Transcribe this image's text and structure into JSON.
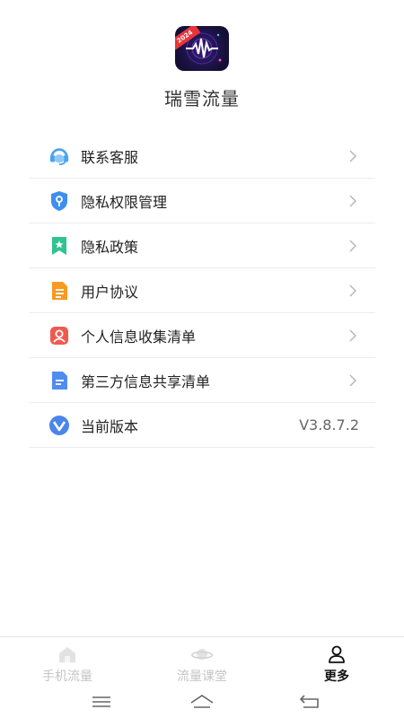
{
  "header": {
    "app_name": "瑞雪流量",
    "logo_badge": "2024"
  },
  "menu": {
    "items": [
      {
        "label": "联系客服",
        "icon": "customer-service-headset-icon"
      },
      {
        "label": "隐私权限管理",
        "icon": "privacy-shield-icon"
      },
      {
        "label": "隐私政策",
        "icon": "policy-bookmark-icon"
      },
      {
        "label": "用户协议",
        "icon": "document-icon"
      },
      {
        "label": "个人信息收集清单",
        "icon": "person-icon"
      },
      {
        "label": "第三方信息共享清单",
        "icon": "share-file-icon"
      },
      {
        "label": "当前版本",
        "icon": "version-v-icon",
        "value": "V3.8.7.2"
      }
    ]
  },
  "bottom_nav": {
    "tabs": [
      {
        "label": "手机流量",
        "icon": "house-icon",
        "active": false
      },
      {
        "label": "流量课堂",
        "icon": "planet-icon",
        "active": false
      },
      {
        "label": "更多",
        "icon": "user-icon",
        "active": true
      }
    ]
  },
  "colors": {
    "accent": "#111111",
    "inactive": "#c4c4c4",
    "divider": "#ececec"
  },
  "system_nav": [
    "menu-icon",
    "home-icon",
    "back-icon"
  ]
}
